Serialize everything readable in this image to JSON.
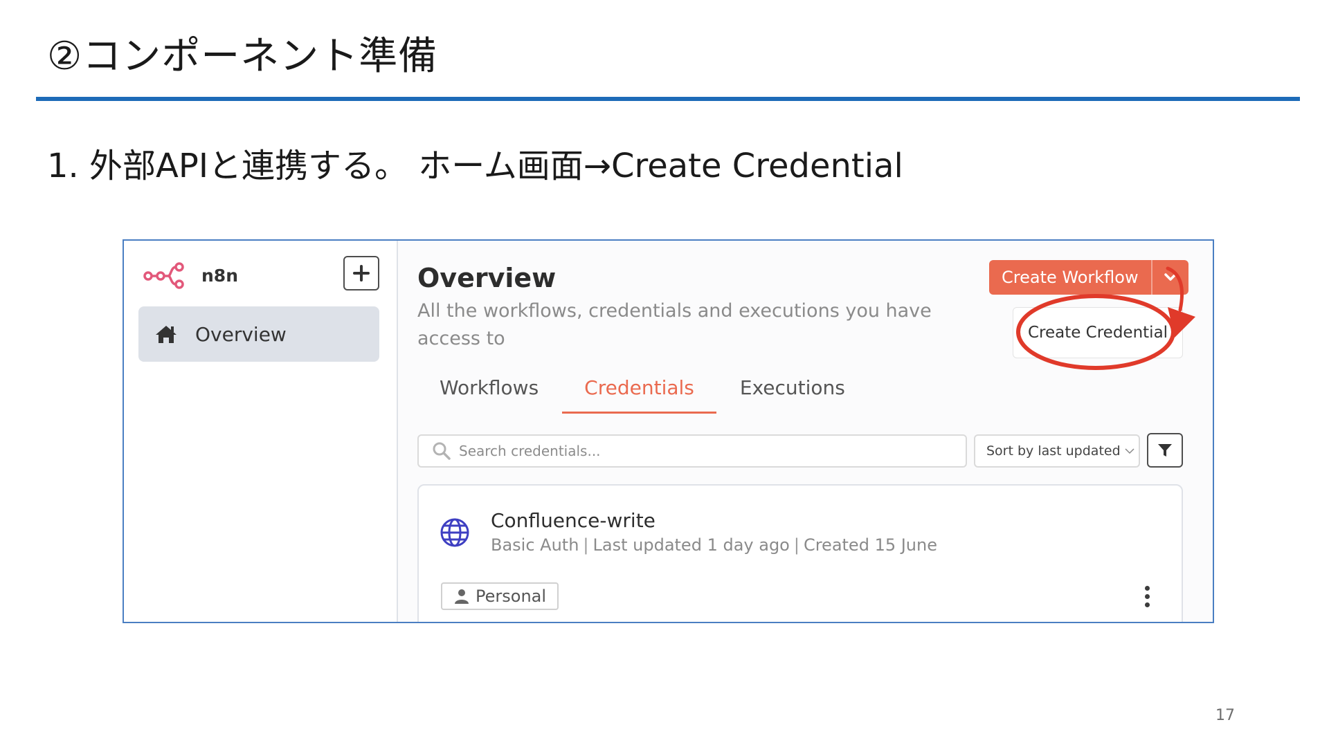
{
  "slide": {
    "title": "②コンポーネント準備",
    "step": "1. 外部APIと連携する。 ホーム画面→Create Credential",
    "page_number": "17"
  },
  "app": {
    "brand_name": "n8n",
    "sidebar": {
      "items": [
        {
          "label": "Overview",
          "icon": "home-icon",
          "active": true
        }
      ]
    },
    "header": {
      "title": "Overview",
      "subtitle": "All the workflows, credentials and executions you have access to",
      "primary_button": "Create Workflow",
      "dropdown_item": "Create Credential"
    },
    "tabs": [
      {
        "label": "Workflows",
        "active": false
      },
      {
        "label": "Credentials",
        "active": true
      },
      {
        "label": "Executions",
        "active": false
      }
    ],
    "search": {
      "placeholder": "Search credentials..."
    },
    "sort": {
      "value": "Sort by last updated"
    },
    "credentials": [
      {
        "name": "Confluence-write",
        "type": "Basic Auth",
        "updated": "Last updated 1 day ago",
        "created": "Created 15 June",
        "owner": "Personal"
      }
    ]
  },
  "colors": {
    "accent": "#ea6a4f",
    "title_rule": "#1d6bb8",
    "annotation": "#e03a2a",
    "sidebar_active": "#dde1e8"
  }
}
